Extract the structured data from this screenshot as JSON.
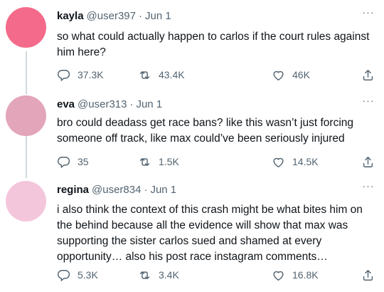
{
  "tweets": [
    {
      "name": "kayla",
      "handle": "@user397",
      "separator": "·",
      "date": "Jun 1",
      "text": "so what could actually happen to carlos if the court rules against him here?",
      "replies": "37.3K",
      "retweets": "43.4K",
      "likes": "46K",
      "avatar_color": "#f46a8a"
    },
    {
      "name": "eva",
      "handle": "@user313",
      "separator": "·",
      "date": "Jun 1",
      "text": "bro could deadass get race bans? like this wasn’t just forcing someone off track, like max could’ve been seriously injured",
      "replies": "35",
      "retweets": "1.5K",
      "likes": "14.5K",
      "avatar_color": "#e3a5b9"
    },
    {
      "name": "regina",
      "handle": "@user834",
      "separator": "·",
      "date": "Jun 1",
      "text": "i also think the context of this crash might be what bites him on the behind because all the evidence will show that max was supporting the sister carlos sued and shamed at every opportunity… also his post race instagram comments…",
      "replies": "5.3K",
      "retweets": "3.4K",
      "likes": "16.8K",
      "avatar_color": "#f4c6dc"
    }
  ],
  "icons": {
    "more": "more-horizontal-icon",
    "reply": "reply-icon",
    "retweet": "retweet-icon",
    "like": "heart-icon",
    "share": "share-icon"
  },
  "more_glyph": "···",
  "colors": {
    "muted_text": "#536471",
    "main_text": "#0f1419",
    "thread_line": "#cfd9de"
  }
}
